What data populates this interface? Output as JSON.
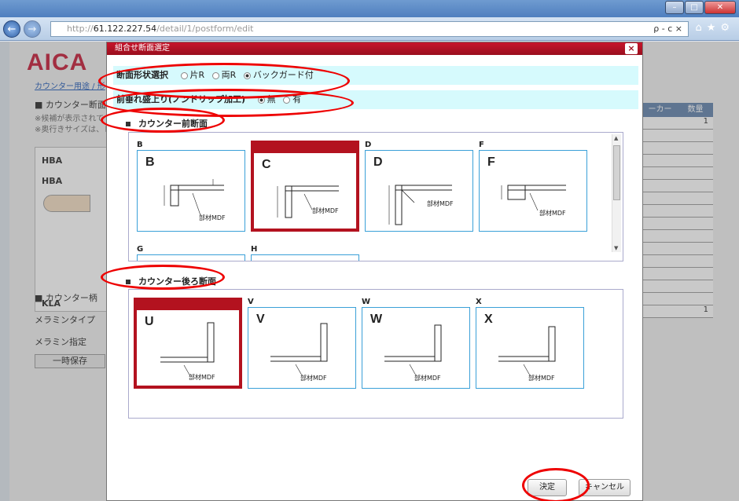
{
  "browser": {
    "url_host": "61.122.227.54",
    "url_path": "/detail/1/postform/edit",
    "url_scheme": "http://",
    "nav_ctrl": "ρ - c ×"
  },
  "page": {
    "logo": "AICA",
    "breadcrumb": "カウンター用途 / 形",
    "section1": "■ カウンター断面",
    "note1": "※候補が表示されて",
    "note2": "※奥行きサイズは、レ",
    "box_labels": [
      "HBA",
      "HBA",
      "KLA"
    ],
    "section2": "■ カウンター柄",
    "row1": "メラミンタイプ",
    "row2": "メラミン指定",
    "save": "一時保存",
    "table_headers": [
      "ーカー",
      "数量"
    ],
    "table_values": [
      "1",
      "1"
    ]
  },
  "dialog": {
    "title": "組合せ断面選定",
    "close": "×",
    "shape_label": "断面形状選択",
    "shape_options": [
      "片R",
      "両R",
      "バックガード付"
    ],
    "drip_label": "前垂れ盛上り(ノンドリップ加工)",
    "drip_options": [
      "無",
      "有"
    ],
    "front_section": "カウンター前断面",
    "back_section": "カウンター後ろ断面",
    "front_cards": [
      {
        "letter": "B",
        "big": "B",
        "material": "部材MDF"
      },
      {
        "letter": "",
        "big": "C",
        "material": "部材MDF"
      },
      {
        "letter": "D",
        "big": "D",
        "material": "部材MDF"
      },
      {
        "letter": "F",
        "big": "F",
        "material": "部材MDF"
      }
    ],
    "front_row2": [
      "G",
      "H"
    ],
    "back_cards": [
      {
        "letter": "",
        "big": "U",
        "material": "部材MDF"
      },
      {
        "letter": "V",
        "big": "V",
        "material": "部材MDF"
      },
      {
        "letter": "W",
        "big": "W",
        "material": "部材MDF"
      },
      {
        "letter": "X",
        "big": "X",
        "material": "部材MDF"
      }
    ],
    "ok": "決定",
    "cancel": "キャンセル"
  }
}
